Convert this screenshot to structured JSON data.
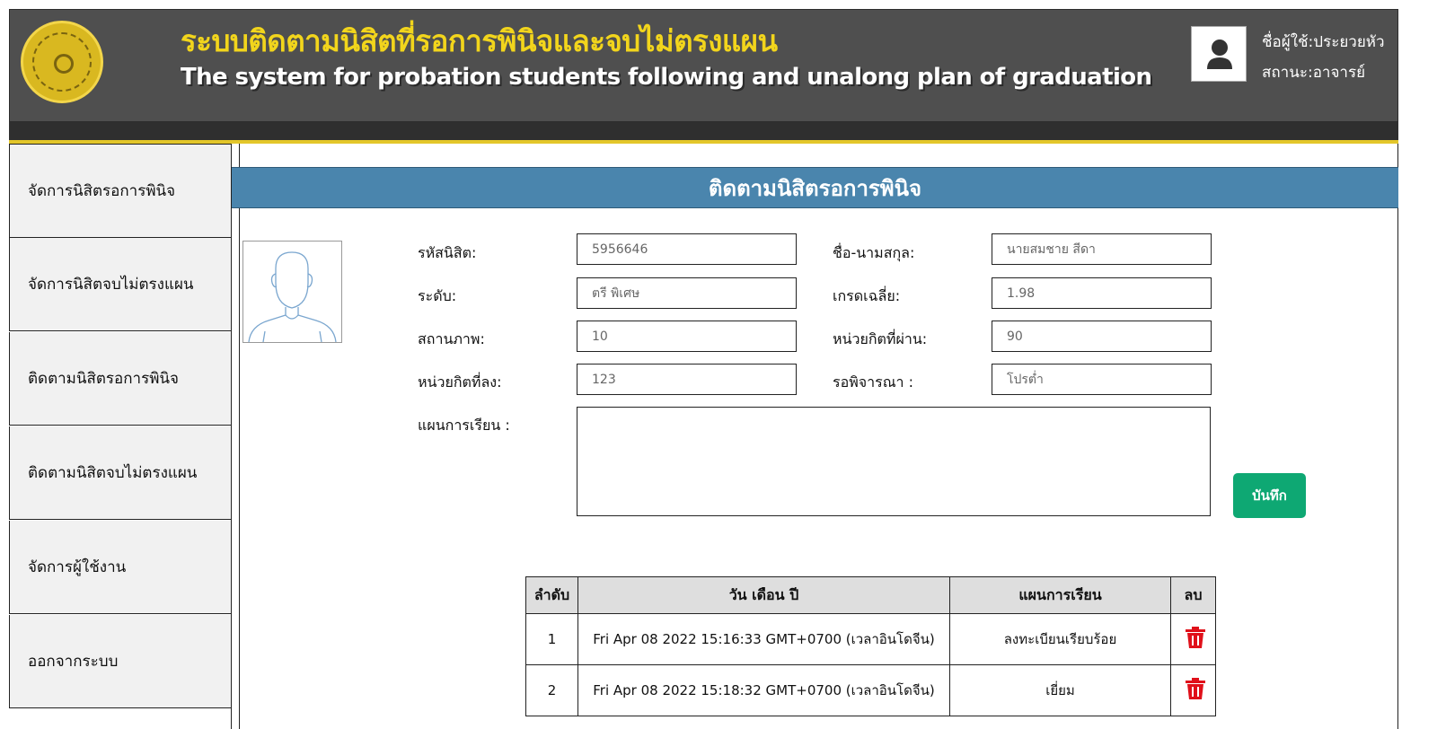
{
  "header": {
    "title_th": "ระบบติดตามนิสิตที่รอการพินิจและจบไม่ตรงแผน",
    "title_en": "The system for probation students following and unalong plan of graduation",
    "user_label": "ชื่อผู้ใช้:ประยวยหัว",
    "role_label": "สถานะ:อาจารย์",
    "logo_icon": "university-seal-logo",
    "avatar_icon": "user-icon"
  },
  "sidebar": {
    "items": [
      {
        "label": "จัดการนิสิตรอการพินิจ"
      },
      {
        "label": "จัดการนิสิตจบไม่ตรงแผน"
      },
      {
        "label": "ติดตามนิสิตรอการพินิจ"
      },
      {
        "label": "ติดตามนิสิตจบไม่ตรงแผน"
      },
      {
        "label": "จัดการผู้ใช้งาน"
      },
      {
        "label": "ออกจากระบบ"
      }
    ]
  },
  "main": {
    "section_title": "ติดตามนิสิตรอการพินิจ",
    "form": {
      "student_id_label": "รหัสนิสิต:",
      "student_id_value": "5956646",
      "name_label": "ชื่อ-นามสกุล:",
      "name_value": "นายสมชาย สีดา",
      "level_label": "ระดับ:",
      "level_value": "ตรี พิเศษ",
      "gpa_label": "เกรดเฉลี่ย:",
      "gpa_value": "1.98",
      "status_label": "สถานภาพ:",
      "status_value": "10",
      "credits_passed_label": "หน่วยกิตที่ผ่าน:",
      "credits_passed_value": "90",
      "credits_registered_label": "หน่วยกิตที่ลง:",
      "credits_registered_value": "123",
      "pending_label": "รอพิจารณา :",
      "pending_value": "โปรต่ำ",
      "plan_label": "แผนการเรียน :",
      "plan_value": "",
      "save_label": "บันทึก"
    },
    "table": {
      "headers": [
        "ลำดับ",
        "วัน เดือน ปี",
        "แผนการเรียน",
        "ลบ"
      ],
      "rows": [
        {
          "no": "1",
          "date": "Fri Apr 08 2022 15:16:33 GMT+0700 (เวลาอินโดจีน)",
          "plan": "ลงทะเบียนเรียบร้อย"
        },
        {
          "no": "2",
          "date": "Fri Apr 08 2022 15:18:32 GMT+0700 (เวลาอินโดจีน)",
          "plan": "เยี่ยม"
        }
      ]
    }
  },
  "colors": {
    "header_bg": "#4f4f4f",
    "title_yellow": "#f2d51c",
    "section_blue": "#4a85ad",
    "save_green": "#0ea873",
    "delete_red": "#e0101a"
  }
}
